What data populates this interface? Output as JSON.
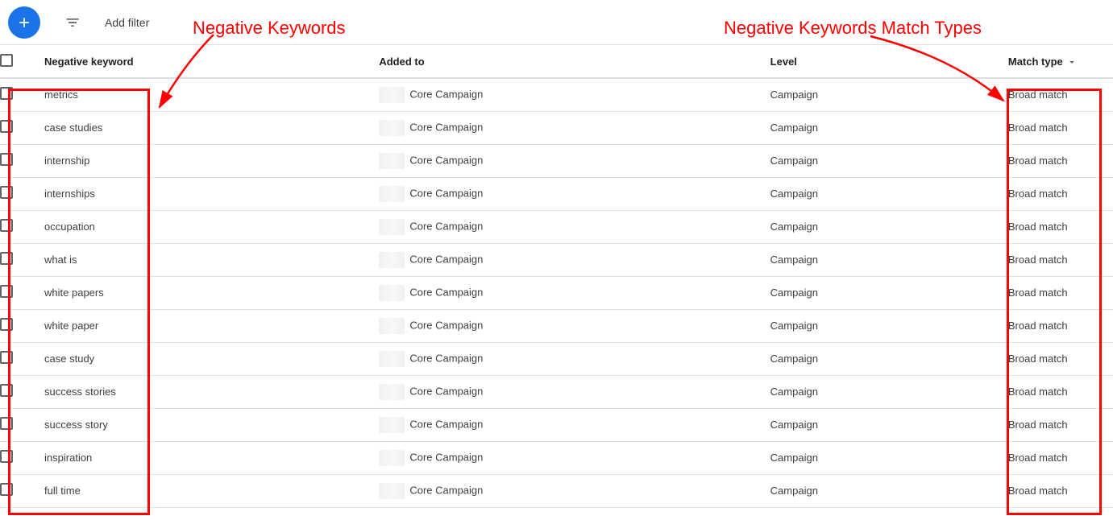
{
  "toolbar": {
    "add_filter": "Add filter"
  },
  "columns": {
    "negative_keyword": "Negative keyword",
    "added_to": "Added to",
    "level": "Level",
    "match_type": "Match type"
  },
  "rows": [
    {
      "keyword": "metrics",
      "added_to": "Core Campaign",
      "level": "Campaign",
      "match_type": "Broad match"
    },
    {
      "keyword": "case studies",
      "added_to": "Core Campaign",
      "level": "Campaign",
      "match_type": "Broad match"
    },
    {
      "keyword": "internship",
      "added_to": "Core Campaign",
      "level": "Campaign",
      "match_type": "Broad match"
    },
    {
      "keyword": "internships",
      "added_to": "Core Campaign",
      "level": "Campaign",
      "match_type": "Broad match"
    },
    {
      "keyword": "occupation",
      "added_to": "Core Campaign",
      "level": "Campaign",
      "match_type": "Broad match"
    },
    {
      "keyword": "what is",
      "added_to": "Core Campaign",
      "level": "Campaign",
      "match_type": "Broad match"
    },
    {
      "keyword": "white papers",
      "added_to": "Core Campaign",
      "level": "Campaign",
      "match_type": "Broad match"
    },
    {
      "keyword": "white paper",
      "added_to": "Core Campaign",
      "level": "Campaign",
      "match_type": "Broad match"
    },
    {
      "keyword": "case study",
      "added_to": "Core Campaign",
      "level": "Campaign",
      "match_type": "Broad match"
    },
    {
      "keyword": "success stories",
      "added_to": "Core Campaign",
      "level": "Campaign",
      "match_type": "Broad match"
    },
    {
      "keyword": "success story",
      "added_to": "Core Campaign",
      "level": "Campaign",
      "match_type": "Broad match"
    },
    {
      "keyword": "inspiration",
      "added_to": "Core Campaign",
      "level": "Campaign",
      "match_type": "Broad match"
    },
    {
      "keyword": "full time",
      "added_to": "Core Campaign",
      "level": "Campaign",
      "match_type": "Broad match"
    }
  ],
  "annotations": {
    "left_label": "Negative Keywords",
    "right_label": "Negative Keywords Match Types"
  }
}
